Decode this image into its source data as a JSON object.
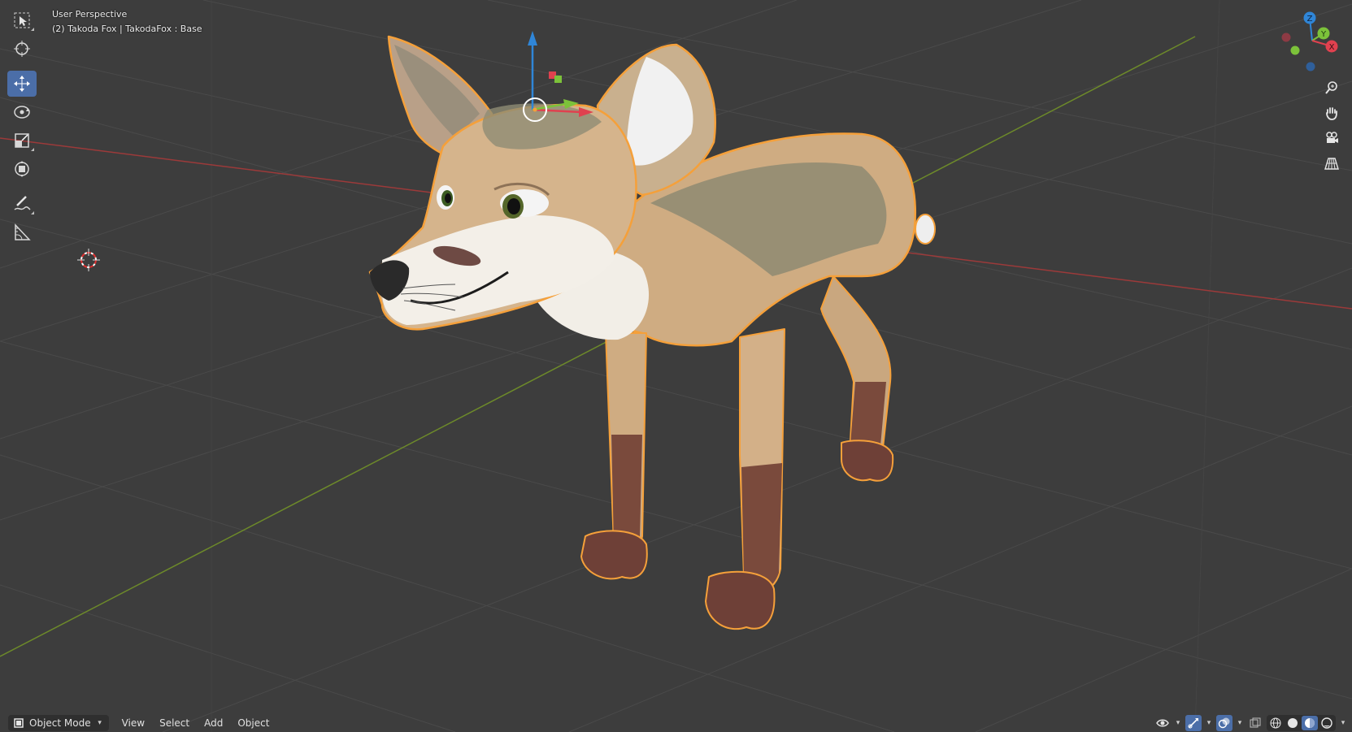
{
  "viewport": {
    "view_name": "User Perspective",
    "object_info": "(2) Takoda Fox | TakodaFox : Base",
    "grid_color": "#4a4a4a",
    "x_axis_color": "#9c3a3a",
    "y_axis_color": "#6d8a2a",
    "selection_outline_color": "#f5a03a"
  },
  "toolbar": {
    "tools": [
      {
        "icon": "select-box-icon",
        "active": false
      },
      {
        "icon": "cursor-icon",
        "active": false
      },
      {
        "icon": "move-icon",
        "active": true
      },
      {
        "icon": "rotate-icon",
        "active": false
      },
      {
        "icon": "scale-icon",
        "active": false
      },
      {
        "icon": "transform-icon",
        "active": false
      },
      {
        "icon": "annotate-icon",
        "active": false
      },
      {
        "icon": "measure-icon",
        "active": false
      }
    ]
  },
  "nav_gizmo": {
    "axes": [
      "Z",
      "Y",
      "X"
    ],
    "z_color": "#2f86d8",
    "y_color": "#7cc23a",
    "x_color": "#e0414f"
  },
  "nav_buttons": [
    "zoom-icon",
    "pan-hand-icon",
    "camera-view-icon",
    "perspective-grid-icon"
  ],
  "header": {
    "mode": "Object Mode",
    "menus": [
      "View",
      "Select",
      "Add",
      "Object"
    ],
    "accent_color": "#4b6ea8"
  }
}
